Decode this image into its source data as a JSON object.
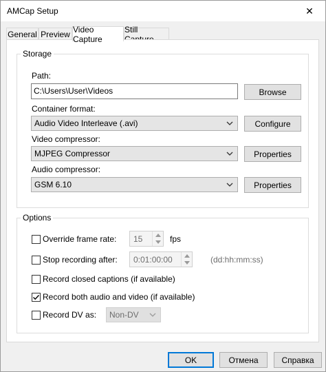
{
  "window": {
    "title": "AMCap Setup",
    "close_glyph": "✕"
  },
  "tabs": [
    {
      "label": "General"
    },
    {
      "label": "Preview"
    },
    {
      "label": "Video Capture"
    },
    {
      "label": "Still Capture"
    }
  ],
  "storage": {
    "legend": "Storage",
    "path_label": "Path:",
    "path_value": "C:\\Users\\User\\Videos",
    "browse_label": "Browse",
    "container_label": "Container format:",
    "container_value": "Audio Video Interleave (.avi)",
    "configure_label": "Configure",
    "video_comp_label": "Video compressor:",
    "video_comp_value": "MJPEG Compressor",
    "video_props_label": "Properties",
    "audio_comp_label": "Audio compressor:",
    "audio_comp_value": "GSM 6.10",
    "audio_props_label": "Properties"
  },
  "options": {
    "legend": "Options",
    "override_label": "Override frame rate:",
    "override_checked": false,
    "fps_value": "15",
    "fps_unit": "fps",
    "stop_label": "Stop recording after:",
    "stop_checked": false,
    "stop_value": "0:01:00:00",
    "stop_hint": "(dd:hh:mm:ss)",
    "cc_label": "Record closed captions (if available)",
    "cc_checked": false,
    "av_label": "Record both audio and video (if available)",
    "av_checked": true,
    "dv_label": "Record DV as:",
    "dv_checked": false,
    "dv_value": "Non-DV"
  },
  "buttons": {
    "ok": "OK",
    "cancel": "Отмена",
    "help": "Справка"
  },
  "icons": {
    "dropdown": "chevron-down-icon",
    "check": "checkmark-icon"
  },
  "colors": {
    "accent": "#0078d7",
    "button_bg": "#e1e1e1",
    "window_bg": "#f0f0f0"
  }
}
